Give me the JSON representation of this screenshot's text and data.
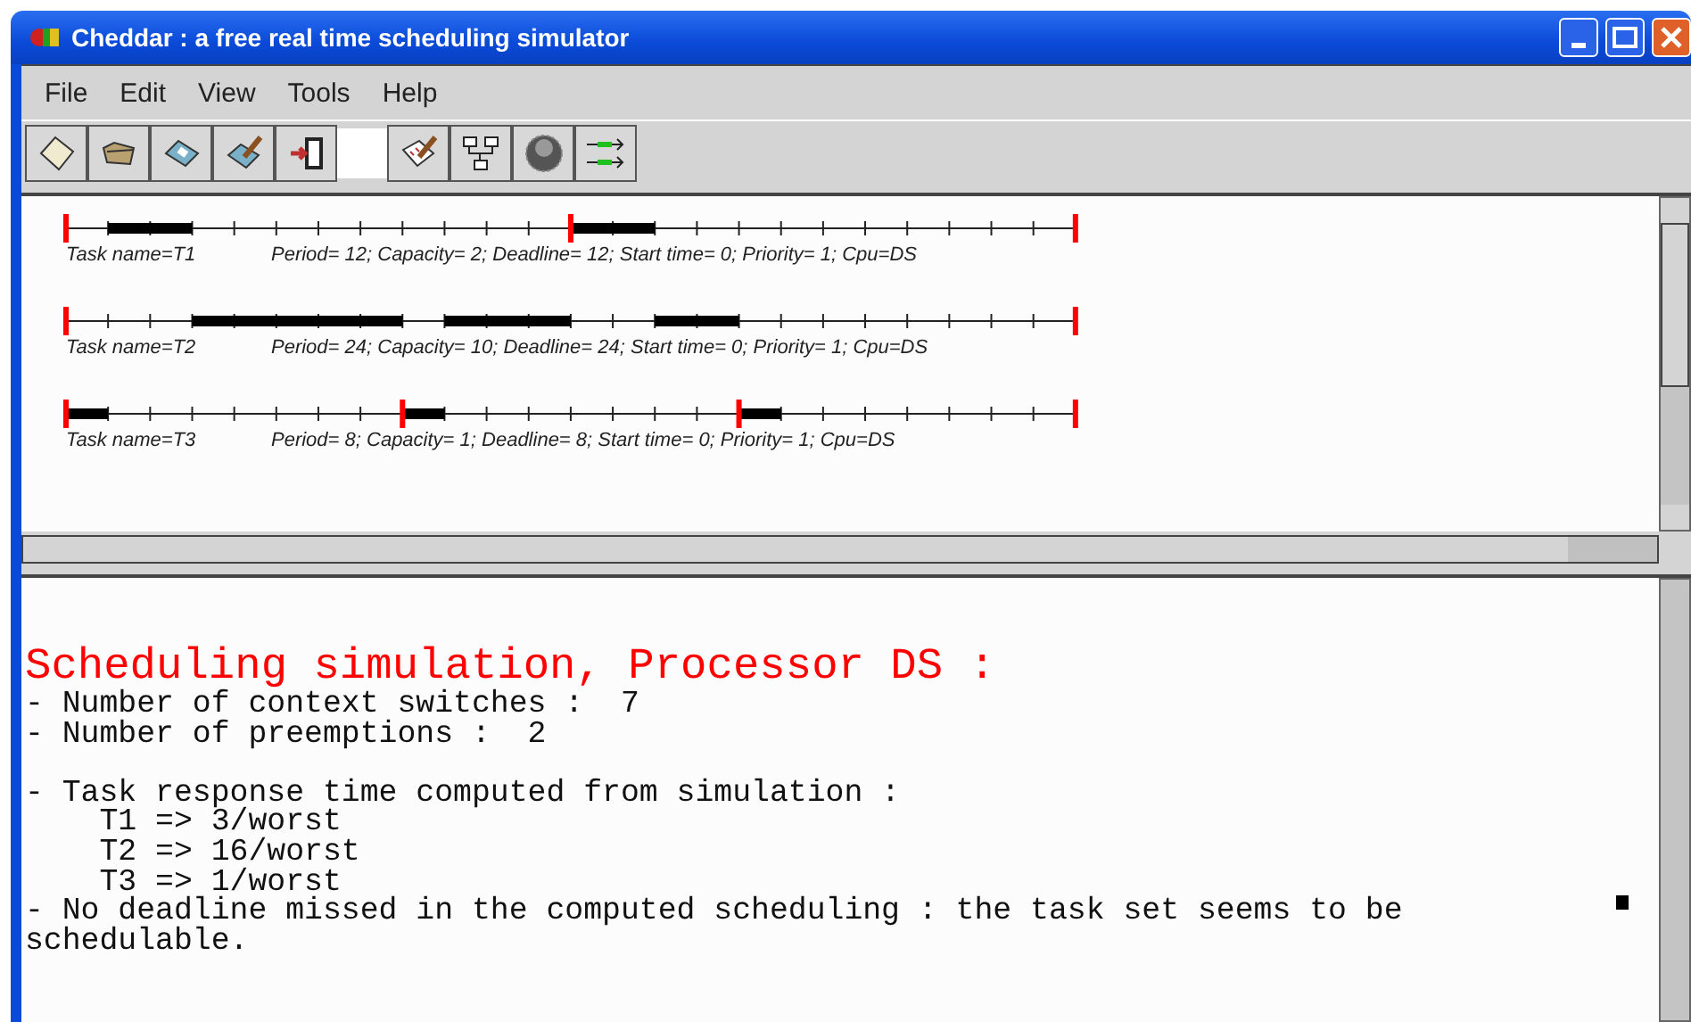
{
  "window": {
    "title": "Cheddar : a free real time scheduling simulator"
  },
  "menu": [
    "File",
    "Edit",
    "View",
    "Tools",
    "Help"
  ],
  "tasks": [
    {
      "name": "Task name=T1",
      "parameters": "Period= 12; Capacity= 2; Deadline= 12; Start time= 0; Priority= 1; Cpu=DS"
    },
    {
      "name": "Task name=T2",
      "parameters": "Period= 24; Capacity= 10; Deadline= 24; Start time= 0; Priority= 1; Cpu=DS"
    },
    {
      "name": "Task name=T3",
      "parameters": "Period= 8; Capacity= 1; Deadline= 8; Start time= 0; Priority= 1; Cpu=DS"
    }
  ],
  "output": {
    "heading": "Scheduling simulation, Processor DS :",
    "blocks": [
      {
        "lines": [
          "- Number of context switches :  7",
          "- Number of preemptions :  2"
        ]
      },
      {
        "lines": [
          "- Task response time computed from simulation :",
          "    T1 => 3/worst",
          "    T2 => 16/worst",
          "    T3 => 1/worst",
          "- No deadline missed in the computed scheduling : the task set seems to be schedulable."
        ]
      }
    ]
  }
}
